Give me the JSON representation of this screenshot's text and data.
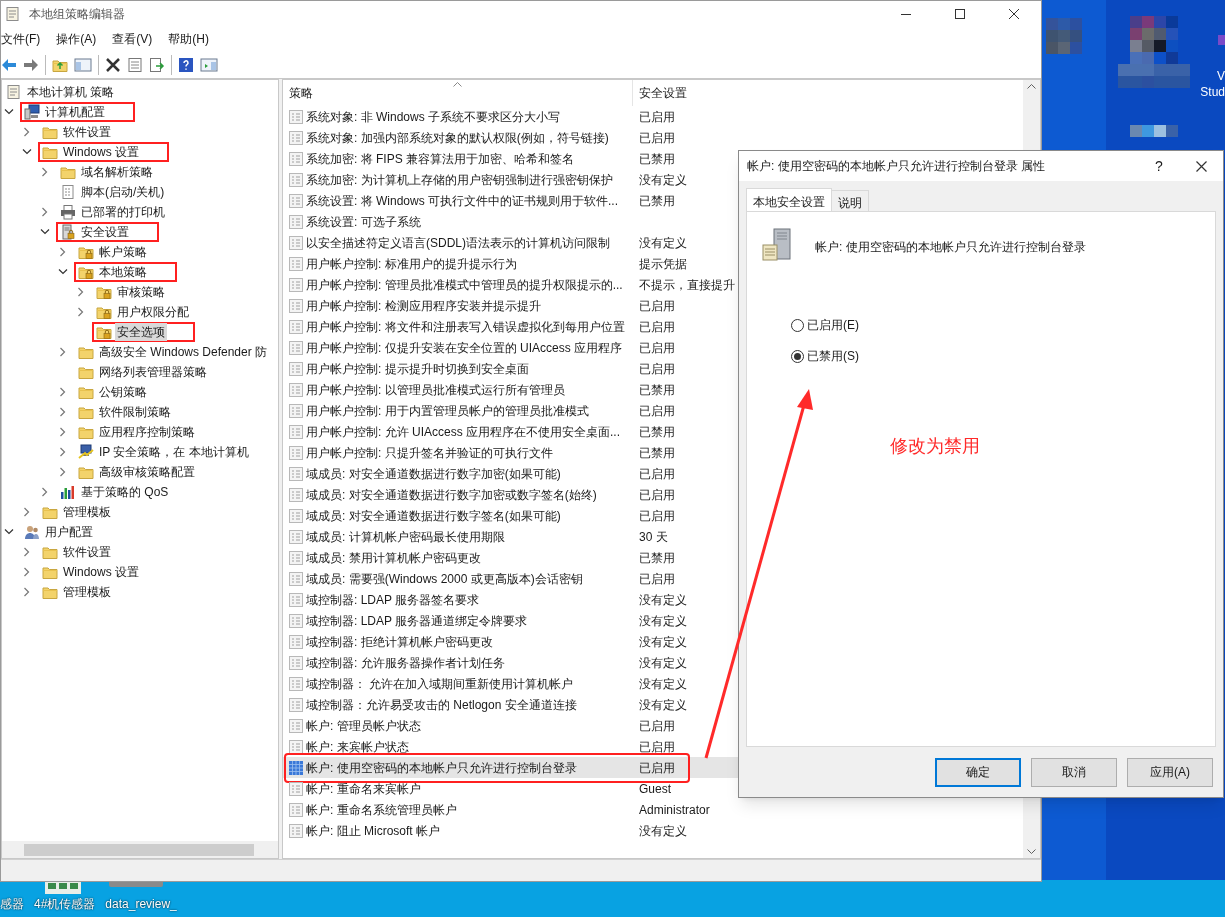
{
  "main_window": {
    "title": "本地组策略编辑器",
    "menu": [
      "文件(F)",
      "操作(A)",
      "查看(V)",
      "帮助(H)"
    ],
    "tree": [
      {
        "label": "本地计算机 策略",
        "kind": "policy",
        "children": [
          {
            "label": "计算机配置",
            "kind": "computer",
            "expanded": true,
            "annotated": true,
            "children": [
              {
                "label": "软件设置",
                "kind": "folder",
                "expanded": false
              },
              {
                "label": "Windows 设置",
                "kind": "folder",
                "expanded": true,
                "annotated": true,
                "children": [
                  {
                    "label": "域名解析策略",
                    "kind": "folder",
                    "expanded": false
                  },
                  {
                    "label": "脚本(启动/关机)",
                    "kind": "script"
                  },
                  {
                    "label": "已部署的打印机",
                    "kind": "printer",
                    "expanded": false
                  },
                  {
                    "label": "安全设置",
                    "kind": "security",
                    "expanded": true,
                    "annotated": true,
                    "children": [
                      {
                        "label": "帐户策略",
                        "kind": "locked-folder",
                        "expanded": false
                      },
                      {
                        "label": "本地策略",
                        "kind": "locked-folder",
                        "expanded": true,
                        "annotated": true,
                        "children": [
                          {
                            "label": "审核策略",
                            "kind": "locked-folder",
                            "expanded": false
                          },
                          {
                            "label": "用户权限分配",
                            "kind": "locked-folder",
                            "expanded": false
                          },
                          {
                            "label": "安全选项",
                            "kind": "locked-folder",
                            "selected": true,
                            "annotated": true
                          }
                        ]
                      },
                      {
                        "label": "高级安全 Windows Defender 防",
                        "kind": "folder",
                        "expanded": false
                      },
                      {
                        "label": "网络列表管理器策略",
                        "kind": "folder"
                      },
                      {
                        "label": "公钥策略",
                        "kind": "folder",
                        "expanded": false
                      },
                      {
                        "label": "软件限制策略",
                        "kind": "folder",
                        "expanded": false
                      },
                      {
                        "label": "应用程序控制策略",
                        "kind": "folder",
                        "expanded": false
                      },
                      {
                        "label": "IP 安全策略，在 本地计算机",
                        "kind": "ip",
                        "expanded": false
                      },
                      {
                        "label": "高级审核策略配置",
                        "kind": "folder",
                        "expanded": false
                      }
                    ]
                  },
                  {
                    "label": "基于策略的 QoS",
                    "kind": "qos",
                    "expanded": false
                  }
                ]
              },
              {
                "label": "管理模板",
                "kind": "folder",
                "expanded": false
              }
            ]
          },
          {
            "label": "用户配置",
            "kind": "user",
            "expanded": true,
            "children": [
              {
                "label": "软件设置",
                "kind": "folder",
                "expanded": false
              },
              {
                "label": "Windows 设置",
                "kind": "folder",
                "expanded": false
              },
              {
                "label": "管理模板",
                "kind": "folder",
                "expanded": false
              }
            ]
          }
        ]
      }
    ],
    "list": {
      "columns": [
        "策略",
        "安全设置"
      ],
      "rows": [
        {
          "name": "系统对象: 非 Windows 子系统不要求区分大小写",
          "setting": "已启用"
        },
        {
          "name": "系统对象: 加强内部系统对象的默认权限(例如，符号链接)",
          "setting": "已启用"
        },
        {
          "name": "系统加密: 将 FIPS 兼容算法用于加密、哈希和签名",
          "setting": "已禁用"
        },
        {
          "name": "系统加密: 为计算机上存储的用户密钥强制进行强密钥保护",
          "setting": "没有定义"
        },
        {
          "name": "系统设置: 将 Windows 可执行文件中的证书规则用于软件...",
          "setting": "已禁用"
        },
        {
          "name": "系统设置: 可选子系统"
        },
        {
          "name": "以安全描述符定义语言(SDDL)语法表示的计算机访问限制",
          "setting": "没有定义"
        },
        {
          "name": "用户帐户控制: 标准用户的提升提示行为",
          "setting": "提示凭据"
        },
        {
          "name": "用户帐户控制: 管理员批准模式中管理员的提升权限提示的...",
          "setting": "不提示，直接提升"
        },
        {
          "name": "用户帐户控制: 检测应用程序安装并提示提升",
          "setting": "已启用"
        },
        {
          "name": "用户帐户控制: 将文件和注册表写入错误虚拟化到每用户位置",
          "setting": "已启用"
        },
        {
          "name": "用户帐户控制: 仅提升安装在安全位置的 UIAccess 应用程序",
          "setting": "已启用"
        },
        {
          "name": "用户帐户控制: 提示提升时切换到安全桌面",
          "setting": "已启用"
        },
        {
          "name": "用户帐户控制: 以管理员批准模式运行所有管理员",
          "setting": "已禁用"
        },
        {
          "name": "用户帐户控制: 用于内置管理员帐户的管理员批准模式",
          "setting": "已启用"
        },
        {
          "name": "用户帐户控制: 允许 UIAccess 应用程序在不使用安全桌面...",
          "setting": "已禁用"
        },
        {
          "name": "用户帐户控制: 只提升签名并验证的可执行文件",
          "setting": "已禁用"
        },
        {
          "name": "域成员: 对安全通道数据进行数字加密(如果可能)",
          "setting": "已启用"
        },
        {
          "name": "域成员: 对安全通道数据进行数字加密或数字签名(始终)",
          "setting": "已启用"
        },
        {
          "name": "域成员: 对安全通道数据进行数字签名(如果可能)",
          "setting": "已启用"
        },
        {
          "name": "域成员: 计算机帐户密码最长使用期限",
          "setting": "30 天"
        },
        {
          "name": "域成员: 禁用计算机帐户密码更改",
          "setting": "已禁用"
        },
        {
          "name": "域成员: 需要强(Windows 2000 或更高版本)会话密钥",
          "setting": "已启用"
        },
        {
          "name": "域控制器: LDAP 服务器签名要求",
          "setting": "没有定义"
        },
        {
          "name": "域控制器: LDAP 服务器通道绑定令牌要求",
          "setting": "没有定义"
        },
        {
          "name": "域控制器: 拒绝计算机帐户密码更改",
          "setting": "没有定义"
        },
        {
          "name": "域控制器: 允许服务器操作者计划任务",
          "setting": "没有定义"
        },
        {
          "name": "域控制器：  允许在加入域期间重新使用计算机帐户",
          "setting": "没有定义"
        },
        {
          "name": "域控制器：允许易受攻击的 Netlogon 安全通道连接",
          "setting": "没有定义"
        },
        {
          "name": "帐户: 管理员帐户状态",
          "setting": "已启用"
        },
        {
          "name": "帐户: 来宾帐户状态",
          "setting": "已启用"
        },
        {
          "name": "帐户: 使用空密码的本地帐户只允许进行控制台登录",
          "setting": "已启用",
          "selected": true,
          "annotated": true
        },
        {
          "name": "帐户: 重命名来宾帐户",
          "setting": "Guest"
        },
        {
          "name": "帐户: 重命名系统管理员帐户",
          "setting": "Administrator"
        },
        {
          "name": "帐户: 阻止 Microsoft 帐户",
          "setting": "没有定义"
        }
      ]
    }
  },
  "dialog": {
    "title": "帐户: 使用空密码的本地帐户只允许进行控制台登录 属性",
    "help": "?",
    "tabs": [
      {
        "label": "本地安全设置",
        "selected": true
      },
      {
        "label": "说明",
        "selected": false
      }
    ],
    "policy_name": "帐户: 使用空密码的本地帐户只允许进行控制台登录",
    "options": [
      {
        "label": "已启用(E)",
        "selected": false
      },
      {
        "label": "已禁用(S)",
        "selected": true
      }
    ],
    "annotation": "修改为禁用",
    "buttons": [
      {
        "label": "确定",
        "default": true
      },
      {
        "label": "取消",
        "default": false
      },
      {
        "label": "应用(A)",
        "default": false
      }
    ]
  },
  "desktop": {
    "right_labels": [
      "V",
      "Stud"
    ],
    "icon_labels": [
      "感器",
      "4#机传感器",
      "data_review_"
    ]
  }
}
